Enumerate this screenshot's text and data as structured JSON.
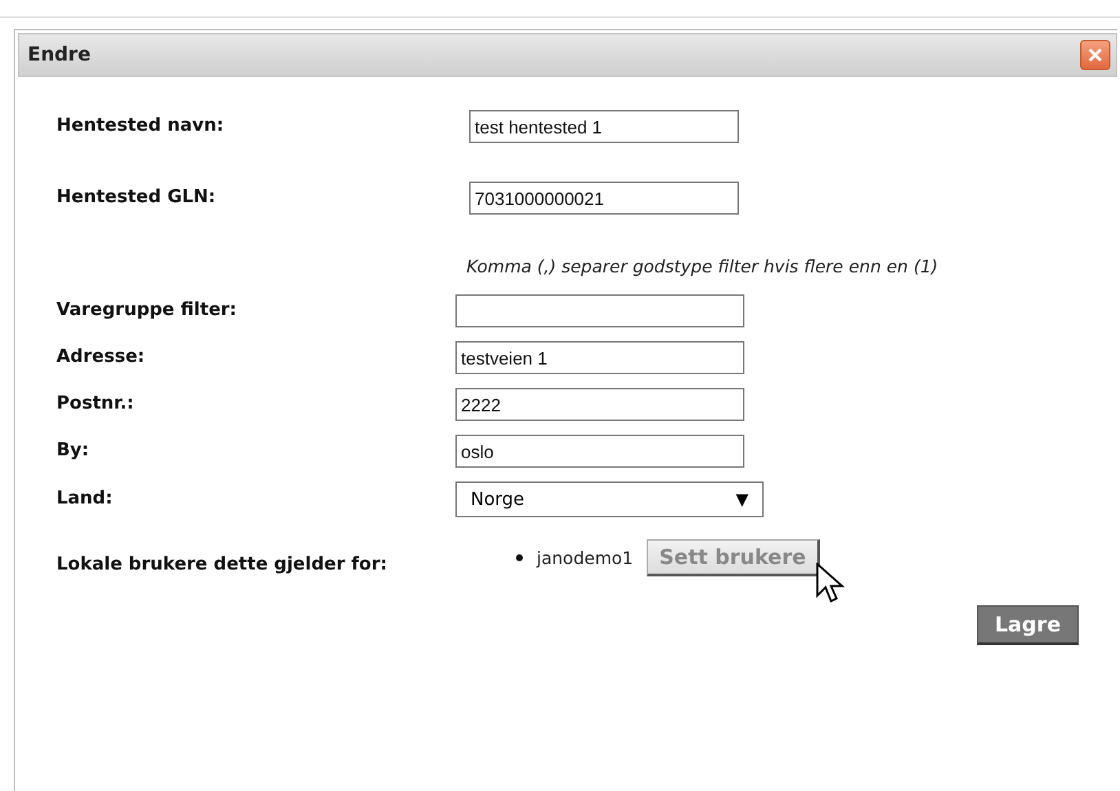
{
  "dialog": {
    "title": "Endre"
  },
  "rows": [
    {
      "kind": "text",
      "label": "Hentested navn:",
      "value": "test hentested 1"
    },
    {
      "kind": "text",
      "label": "Hentested GLN:",
      "value": "7031000000021"
    },
    {
      "kind": "hint",
      "text": "Komma (,) separer godstype filter hvis flere enn en (1)"
    },
    {
      "kind": "text",
      "label": "Varegruppe filter:"
    },
    {
      "kind": "text",
      "label": "Adresse:",
      "value": "testveien 1"
    },
    {
      "kind": "text",
      "label": "Postnr.:",
      "value": "2222"
    },
    {
      "kind": "text",
      "label": "By:",
      "value": "oslo"
    },
    {
      "kind": "select",
      "label": "Land:",
      "value": "Norge",
      "arrow": "▼"
    },
    {
      "kind": "users",
      "label": "Lokale brukere dette gjelder for:",
      "users": [
        "janodemo1"
      ],
      "button": "Sett brukere"
    }
  ],
  "save_button": "Lagre"
}
